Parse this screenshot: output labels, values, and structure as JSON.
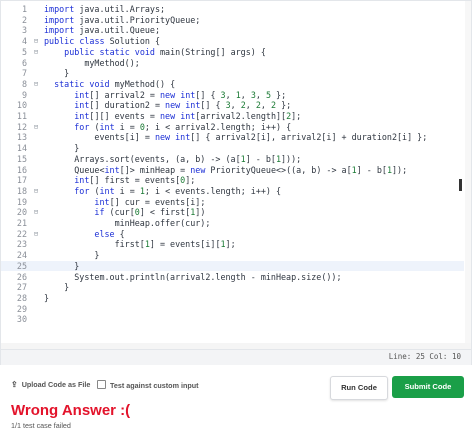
{
  "editor": {
    "status": "Line: 25 Col: 10",
    "lines": [
      {
        "num": "1",
        "fold": "",
        "text": "import java.util.Arrays;"
      },
      {
        "num": "2",
        "fold": "",
        "text": "import java.util.PriorityQueue;"
      },
      {
        "num": "3",
        "fold": "",
        "text": "import java.util.Queue;"
      },
      {
        "num": "4",
        "fold": "⊟",
        "text": "public class Solution {"
      },
      {
        "num": "5",
        "fold": "⊟",
        "text": "    public static void main(String[] args) {"
      },
      {
        "num": "6",
        "fold": "",
        "text": "        myMethod();"
      },
      {
        "num": "7",
        "fold": "",
        "text": "    }"
      },
      {
        "num": "8",
        "fold": "⊟",
        "text": "  static void myMethod() {"
      },
      {
        "num": "9",
        "fold": "",
        "text": "      int[] arrival2 = new int[] { 3, 1, 3, 5 };"
      },
      {
        "num": "10",
        "fold": "",
        "text": "      int[] duration2 = new int[] { 3, 2, 2, 2 };"
      },
      {
        "num": "11",
        "fold": "",
        "text": "      int[][] events = new int[arrival2.length][2];"
      },
      {
        "num": "12",
        "fold": "⊟",
        "text": "      for (int i = 0; i < arrival2.length; i++) {"
      },
      {
        "num": "13",
        "fold": "",
        "text": "          events[i] = new int[] { arrival2[i], arrival2[i] + duration2[i] };"
      },
      {
        "num": "14",
        "fold": "",
        "text": "      }"
      },
      {
        "num": "15",
        "fold": "",
        "text": "      Arrays.sort(events, (a, b) -> (a[1] - b[1]));"
      },
      {
        "num": "16",
        "fold": "",
        "text": "      Queue<int[]> minHeap = new PriorityQueue<>((a, b) -> a[1] - b[1]);"
      },
      {
        "num": "17",
        "fold": "",
        "text": "      int[] first = events[0];"
      },
      {
        "num": "18",
        "fold": "⊟",
        "text": "      for (int i = 1; i < events.length; i++) {"
      },
      {
        "num": "19",
        "fold": "",
        "text": "          int[] cur = events[i];"
      },
      {
        "num": "20",
        "fold": "⊟",
        "text": "          if (cur[0] < first[1])"
      },
      {
        "num": "21",
        "fold": "",
        "text": "              minHeap.offer(cur);"
      },
      {
        "num": "22",
        "fold": "⊟",
        "text": "          else {"
      },
      {
        "num": "23",
        "fold": "",
        "text": "              first[1] = events[i][1];"
      },
      {
        "num": "24",
        "fold": "",
        "text": "          }"
      },
      {
        "num": "25",
        "fold": "",
        "text": "      }"
      },
      {
        "num": "26",
        "fold": "",
        "text": "      System.out.println(arrival2.length - minHeap.size());"
      },
      {
        "num": "27",
        "fold": "",
        "text": "    }"
      },
      {
        "num": "28",
        "fold": "",
        "text": "}"
      },
      {
        "num": "29",
        "fold": "",
        "text": ""
      },
      {
        "num": "30",
        "fold": "",
        "text": ""
      }
    ],
    "active_line": 25
  },
  "actions": {
    "upload_label": "Upload Code as File",
    "upload_icon": "upload-icon",
    "custom_input_label": "Test against custom input",
    "run_label": "Run Code",
    "submit_label": "Submit Code"
  },
  "result": {
    "title": "Wrong Answer :(",
    "subtitle": "1/1 test case failed",
    "title_color": "#e3132b"
  },
  "colors": {
    "submit_bg": "#1a9f48",
    "keyword": "#1c2fd6",
    "number": "#1a7a34"
  }
}
